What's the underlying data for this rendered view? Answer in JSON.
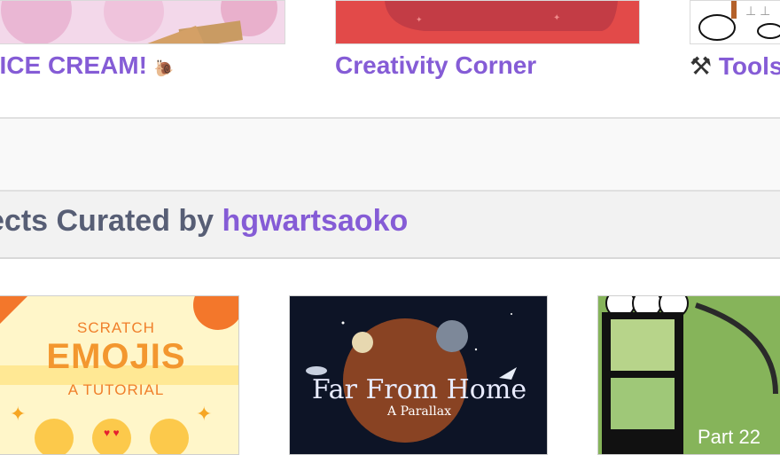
{
  "top_row": {
    "items": [
      {
        "title": "ICE CREAM!"
      },
      {
        "title": "Creativity Corner"
      },
      {
        "title": "Tools"
      }
    ]
  },
  "curated": {
    "prefix": "ects Curated by",
    "username": "hgwartsaoko"
  },
  "projects": [
    {
      "line1": "SCRATCH",
      "line2": "EMOJIS",
      "line3": "A TUTORIAL"
    },
    {
      "title": "Far From Home",
      "subtitle": "A Parallax"
    },
    {
      "label": "Part 22"
    }
  ],
  "colors": {
    "accent": "#855cd6",
    "heading": "#575e75"
  }
}
